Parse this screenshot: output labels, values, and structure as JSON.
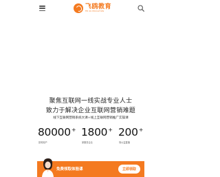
{
  "header": {
    "logo": {
      "name": "飞鸥教育",
      "subtitle": "FEI OU EDUCATION",
      "icon": "logo-mark"
    },
    "menu_icon": "menu-icon",
    "search_icon": "search-icon"
  },
  "hero": {
    "headline_line1": "聚焦互联网一线实战专业人士",
    "headline_line2": "致力于解决企业互联网营销难题",
    "subheadline": "线下互联网营销系统大课+线上互联网营销推广实操课"
  },
  "stats": [
    {
      "value": "80000",
      "suffix": "+",
      "label": "影响用户"
    },
    {
      "value": "1800",
      "suffix": "+",
      "label": "家服务企业"
    },
    {
      "value": "200",
      "suffix": "+",
      "label": "场公益直播"
    }
  ],
  "banner": {
    "text": "免费领取体验课",
    "button_label": "立即领取",
    "accent_color": "#f47a20"
  },
  "colors": {
    "brand": "#f47a20",
    "text": "#222222",
    "muted": "#666666"
  }
}
